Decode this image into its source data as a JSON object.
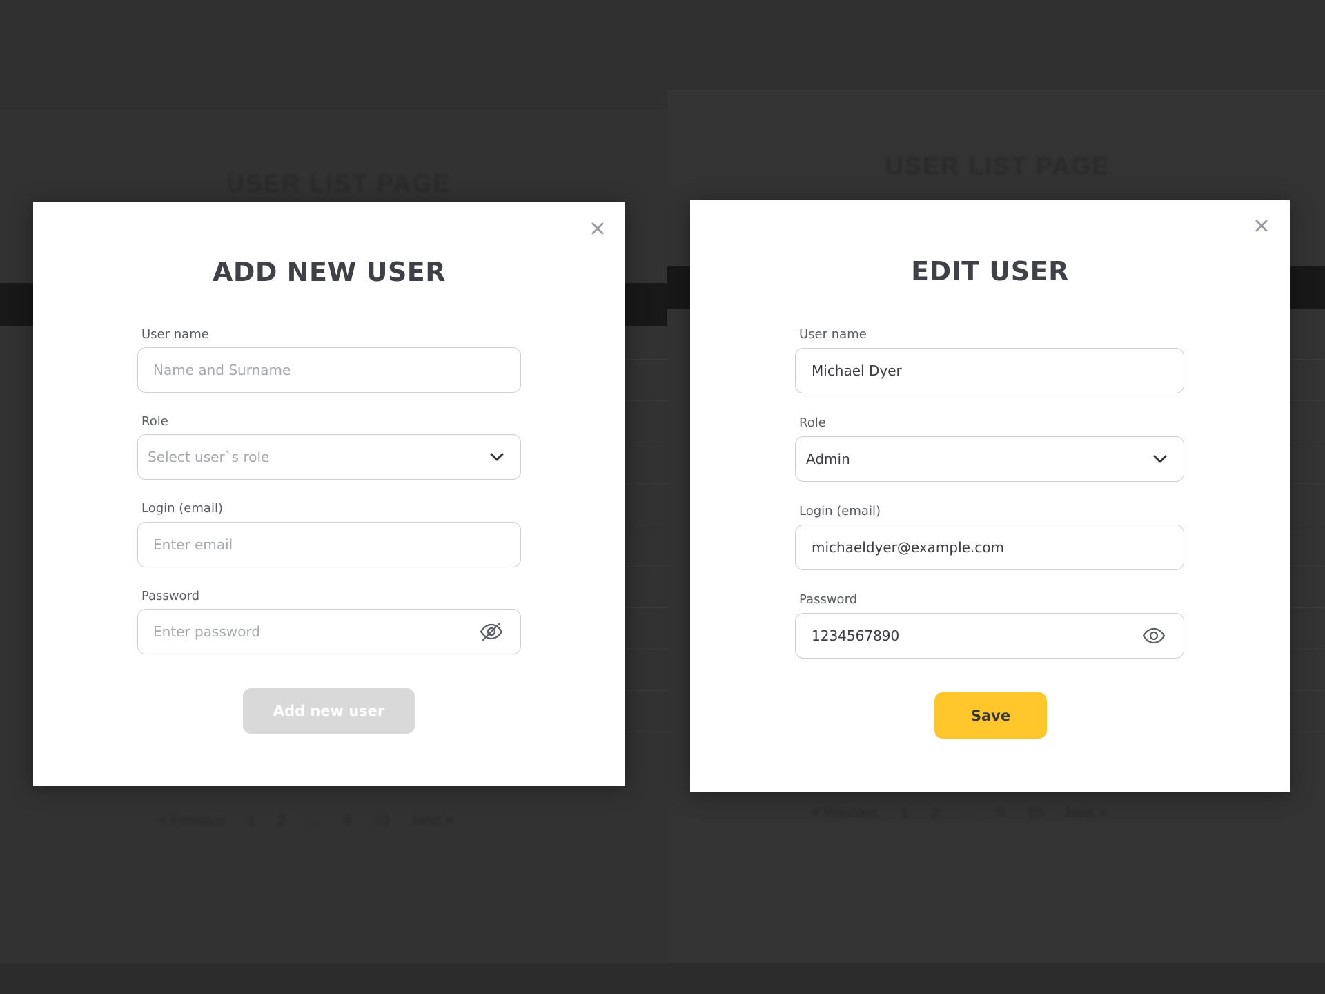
{
  "background": {
    "page_title": "USER LIST PAGE",
    "pagination": [
      "< Previous",
      "1",
      "2",
      "...",
      "9",
      "10",
      "Next >"
    ]
  },
  "colors": {
    "backdrop": "#333333",
    "modal_bg": "#ffffff",
    "title_text": "#3f4147",
    "disabled_button": "#d9d9d9",
    "primary_button": "#ffc72c",
    "input_border": "#cfcfd2"
  },
  "add_modal": {
    "title": "ADD NEW USER",
    "close_icon": "close-icon",
    "fields": {
      "username": {
        "label": "User name",
        "placeholder": "Name and Surname"
      },
      "role": {
        "label": "Role",
        "placeholder": "Select user`s role",
        "icon": "chevron-down-icon"
      },
      "email": {
        "label": "Login (email)",
        "placeholder": "Enter email"
      },
      "password": {
        "label": "Password",
        "placeholder": "Enter password",
        "icon": "eye-off-icon"
      }
    },
    "submit_label": "Add new user",
    "submit_state": "disabled"
  },
  "edit_modal": {
    "title": "EDIT USER",
    "close_icon": "close-icon",
    "fields": {
      "username": {
        "label": "User name",
        "value": "Michael Dyer"
      },
      "role": {
        "label": "Role",
        "value": "Admin",
        "icon": "chevron-down-icon"
      },
      "email": {
        "label": "Login (email)",
        "value": "michaeldyer@example.com"
      },
      "password": {
        "label": "Password",
        "value": "1234567890",
        "icon": "eye-icon"
      }
    },
    "submit_label": "Save"
  }
}
